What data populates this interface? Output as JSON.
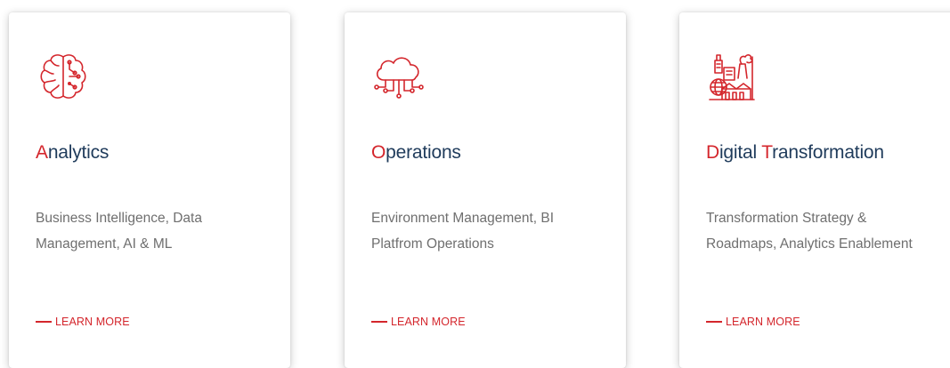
{
  "accent_color": "#d4262c",
  "title_color": "#1f3b5b",
  "cards": [
    {
      "icon": "brain-icon",
      "title_parts": [
        {
          "text": "A",
          "accent": true
        },
        {
          "text": "nalytics",
          "accent": false
        }
      ],
      "description": "Business Intelligence, Data Management, AI & ML",
      "link_label": "LEARN MORE"
    },
    {
      "icon": "cloud-network-icon",
      "title_parts": [
        {
          "text": "O",
          "accent": true
        },
        {
          "text": "perations",
          "accent": false
        }
      ],
      "description": "Environment Management, BI Platfrom Operations",
      "link_label": "LEARN MORE"
    },
    {
      "icon": "industry-globe-icon",
      "title_parts": [
        {
          "text": "D",
          "accent": true
        },
        {
          "text": "igital ",
          "accent": false
        },
        {
          "text": "T",
          "accent": true
        },
        {
          "text": "ransformation",
          "accent": false
        }
      ],
      "description": "Transformation Strategy & Roadmaps, Analytics Enablement",
      "link_label": "LEARN MORE"
    }
  ]
}
